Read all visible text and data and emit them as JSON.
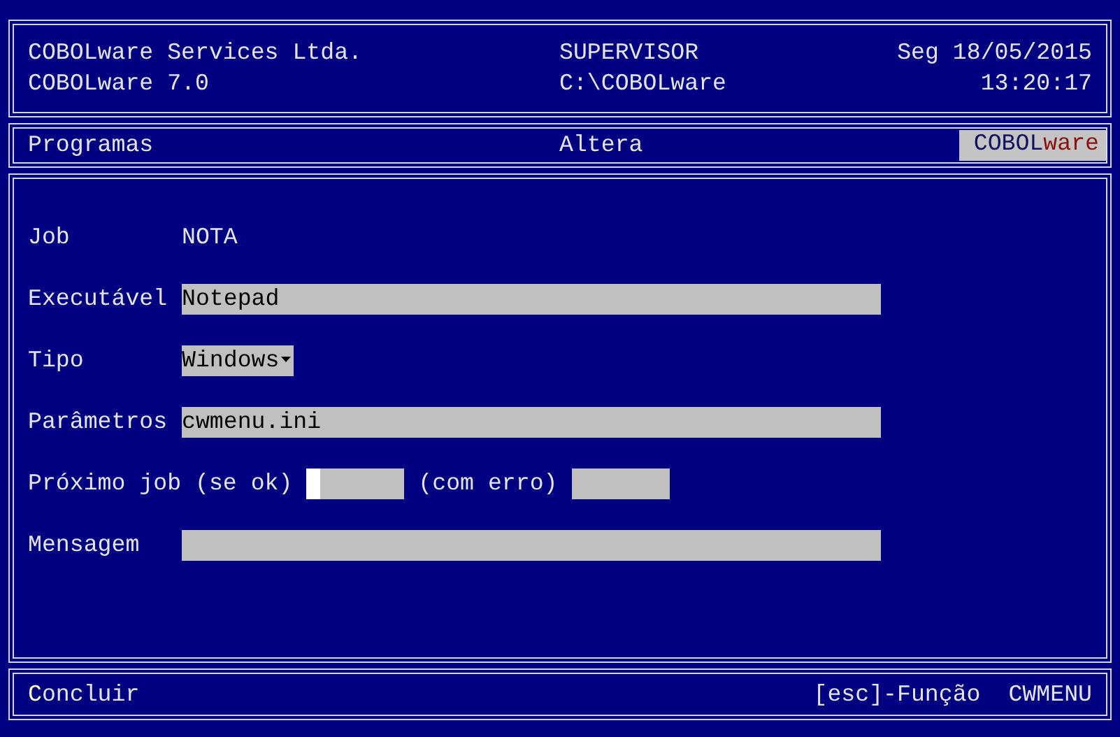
{
  "header": {
    "company": "COBOLware Services Ltda.",
    "product": "COBOLware 7.0",
    "user": "SUPERVISOR",
    "path": "C:\\COBOLware",
    "date": "Seg 18/05/2015",
    "time": "13:20:17"
  },
  "subheader": {
    "module": "Programas",
    "mode": "Altera",
    "logo": {
      "prefix": "COBOL",
      "suffix": "ware"
    }
  },
  "form": [
    {
      "kind": "display",
      "label": "Job",
      "value": "NOTA"
    },
    {
      "kind": "text",
      "label": "Executável",
      "value": "Notepad"
    },
    {
      "kind": "select",
      "label": "Tipo",
      "value": "Windows"
    },
    {
      "kind": "text",
      "label": "Parâmetros",
      "value": "cwmenu.ini"
    },
    {
      "kind": "pair",
      "label": "Próximo job (se ok)",
      "focused": true,
      "second_label": "(com erro)"
    },
    {
      "kind": "text",
      "label": "Mensagem"
    }
  ],
  "footer": {
    "action": "Concluir",
    "hint": "[esc]-Função",
    "program": "CWMENU"
  }
}
